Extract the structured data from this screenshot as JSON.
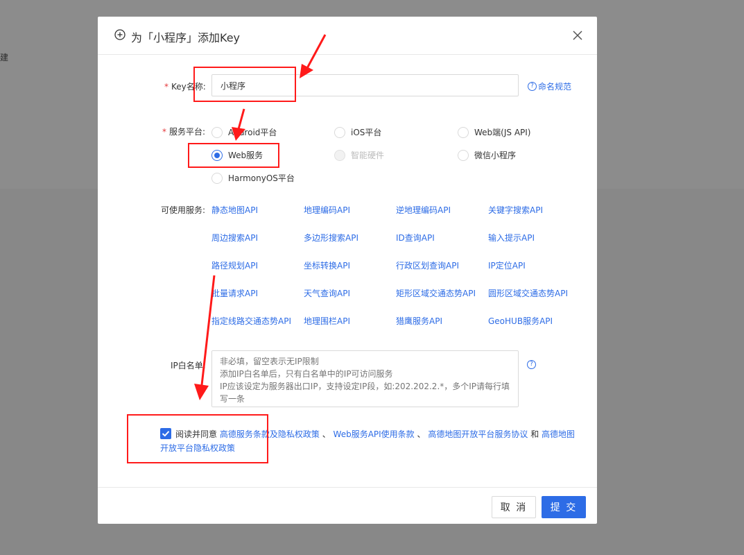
{
  "background": {
    "edge_text": "建"
  },
  "modal": {
    "title": "为「小程序」添加Key",
    "form": {
      "key_name_label": "Key名称:",
      "key_name_value": "小程序",
      "naming_rule_link": "命名规范",
      "platform_label": "服务平台:",
      "platforms": [
        {
          "label": "Android平台",
          "checked": false,
          "disabled": false
        },
        {
          "label": "iOS平台",
          "checked": false,
          "disabled": false
        },
        {
          "label": "Web端(JS API)",
          "checked": false,
          "disabled": false
        },
        {
          "label": "Web服务",
          "checked": true,
          "disabled": false
        },
        {
          "label": "智能硬件",
          "checked": false,
          "disabled": true
        },
        {
          "label": "微信小程序",
          "checked": false,
          "disabled": false
        },
        {
          "label": "HarmonyOS平台",
          "checked": false,
          "disabled": false
        }
      ],
      "services_label": "可使用服务:",
      "services": [
        "静态地图API",
        "地理编码API",
        "逆地理编码API",
        "关键字搜索API",
        "周边搜索API",
        "多边形搜索API",
        "ID查询API",
        "输入提示API",
        "路径规划API",
        "坐标转换API",
        "行政区划查询API",
        "IP定位API",
        "批量请求API",
        "天气查询API",
        "矩形区域交通态势API",
        "圆形区域交通态势API",
        "指定线路交通态势API",
        "地理围栏API",
        "猎鹰服务API",
        "GeoHUB服务API"
      ],
      "ip_label": "IP白名单:",
      "ip_placeholder": "非必填，留空表示无IP限制\n添加IP白名单后，只有白名单中的IP可访问服务\nIP应该设定为服务器出口IP，支持设定IP段，如:202.202.2.*，多个IP请每行填写一条",
      "agree": {
        "checked": true,
        "prefix": "阅读并同意",
        "link1": "高德服务条款及隐私权政策",
        "sep1": "、",
        "link2": "Web服务API使用条款",
        "sep2": "、",
        "link3": "高德地图开放平台服务协议",
        "and": "和",
        "link4": "高德地图开放平台隐私权政策"
      }
    },
    "footer": {
      "cancel_label": "取 消",
      "submit_label": "提 交"
    }
  },
  "colors": {
    "accent": "#2d6ce6",
    "required": "#e4393c",
    "annotation": "#ff1a1a"
  }
}
